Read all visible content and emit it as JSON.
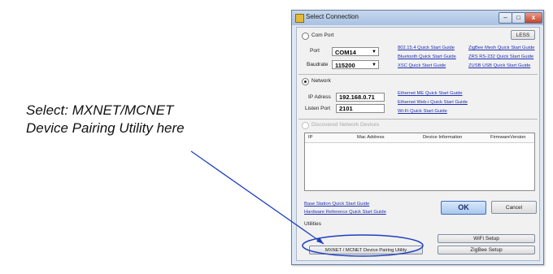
{
  "annotation": {
    "line1": "Select: MXNET/MCNET",
    "line2": "Device Pairing Utility here"
  },
  "window": {
    "title": "Select Connection",
    "min": "–",
    "max": "□",
    "close": "x"
  },
  "com": {
    "radio_label": "Com Port",
    "less_label": "LESS",
    "port_label": "Port",
    "port_value": "COM14",
    "baud_label": "Baudrate",
    "baud_value": "115200",
    "links": [
      "802.15.4 Quick Start Guide",
      "Bluetooth Quick Start Guide",
      "XSC Quick Start Guide",
      "ZigBee Mesh Quick Start Guide",
      "ZRS RS-232 Quick Start Guide",
      "ZUSB USB Quick Start Guide"
    ]
  },
  "network": {
    "radio_label": "Network",
    "ip_label": "IP Adress",
    "ip_value": "192.168.0.71",
    "port_label": "Listen Port",
    "port_value": "2101",
    "links": [
      "Ethernet ME Quick Start Guide",
      "Ethernet Web-i Quick Start Guide",
      "Wi-Fi Quick Start Guide"
    ]
  },
  "discovered": {
    "radio_label": "Discovered Network Devices",
    "columns": [
      "IP",
      "Mac Address",
      "Device Information",
      "FirmwareVersion"
    ]
  },
  "bottom": {
    "links": [
      "Base Station Quick Start Guide",
      "Hardware Reference Quick Start Guide"
    ],
    "ok_label": "OK",
    "cancel_label": "Cancel",
    "utilities_label": "Utilities",
    "wifi_setup": "WiFi Setup",
    "zigbee_setup": "ZigBee Setup",
    "pairing_utility": "MXNET / MCNET Device Pairing Utility"
  },
  "colors": {
    "link": "#1f2fb0",
    "annotation_line": "#1f3fbf",
    "ok_accent": "#3c6fbf"
  }
}
